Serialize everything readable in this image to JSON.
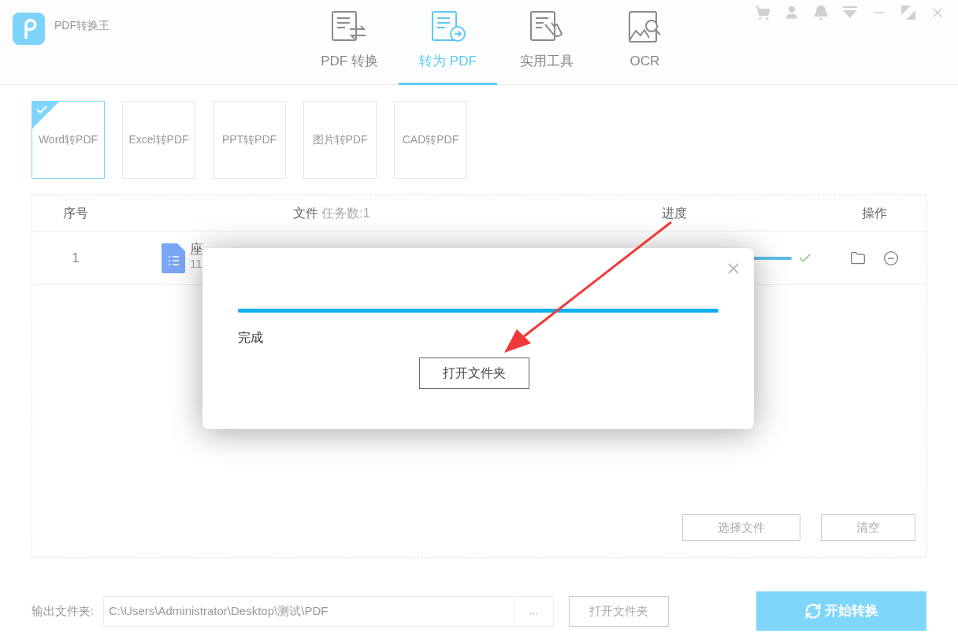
{
  "app": {
    "title": "PDF转换王"
  },
  "tabs": [
    {
      "label": "PDF 转换",
      "kind": "convert",
      "selected": false
    },
    {
      "label": "转为 PDF",
      "kind": "topdf",
      "selected": true
    },
    {
      "label": "实用工具",
      "kind": "tools",
      "selected": false
    },
    {
      "label": "OCR",
      "kind": "ocr",
      "selected": false
    }
  ],
  "types": [
    {
      "label": "Word转PDF",
      "selected": true
    },
    {
      "label": "Excel转PDF",
      "selected": false
    },
    {
      "label": "PPT转PDF",
      "selected": false
    },
    {
      "label": "图片转PDF",
      "selected": false
    },
    {
      "label": "CAD转PDF",
      "selected": false
    }
  ],
  "table": {
    "columns": [
      "序号",
      "文件",
      "进度",
      "操作"
    ],
    "task_count": "任务数:1",
    "rows": [
      {
        "index": "1",
        "name": "座",
        "size": "11",
        "level": 1,
        "done": true
      }
    ]
  },
  "table_buttons": [
    "选择文件",
    "清空"
  ],
  "output": {
    "label": "输出文件夹:",
    "path": "C:\\Users\\Administrator\\Desktop\\测试\\PDF",
    "browse": "...",
    "open": "打开文件夹"
  },
  "start_button": "开始转换",
  "dialog": {
    "level": 1,
    "status": "完成",
    "button": "打开文件夹"
  }
}
